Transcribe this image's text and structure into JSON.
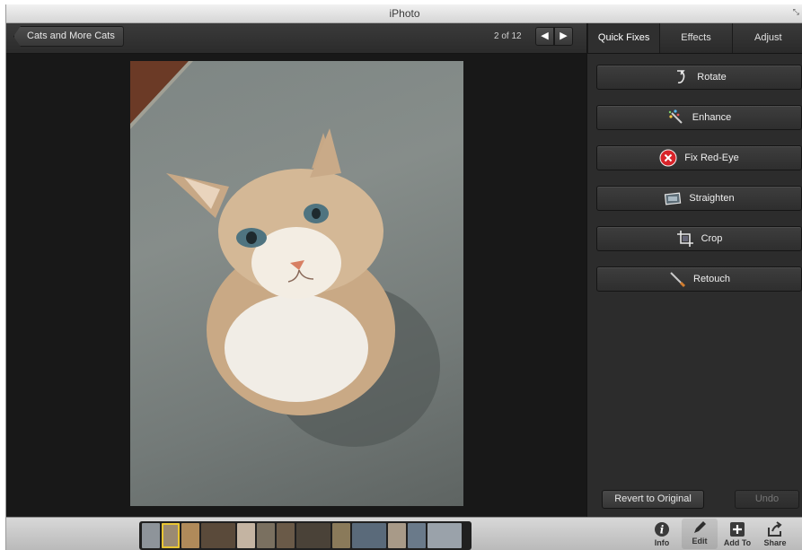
{
  "window": {
    "title": "iPhoto"
  },
  "toolbar": {
    "back_label": "Cats and More Cats",
    "counter": "2 of 12",
    "prev_glyph": "🡐",
    "next_glyph": "🡒"
  },
  "panel": {
    "tabs": [
      {
        "label": "Quick Fixes",
        "active": true
      },
      {
        "label": "Effects",
        "active": false
      },
      {
        "label": "Adjust",
        "active": false
      }
    ],
    "tools": [
      {
        "label": "Rotate",
        "icon": "rotate-icon"
      },
      {
        "label": "Enhance",
        "icon": "magic-wand-icon"
      },
      {
        "label": "Fix Red-Eye",
        "icon": "red-eye-icon"
      },
      {
        "label": "Straighten",
        "icon": "straighten-icon"
      },
      {
        "label": "Crop",
        "icon": "crop-icon"
      },
      {
        "label": "Retouch",
        "icon": "brush-icon"
      }
    ],
    "revert_label": "Revert to Original",
    "undo_label": "Undo"
  },
  "bottombar": {
    "items": [
      {
        "label": "Info",
        "icon": "info-icon"
      },
      {
        "label": "Edit",
        "icon": "pencil-icon",
        "active": true
      },
      {
        "label": "Add To",
        "icon": "plus-icon"
      },
      {
        "label": "Share",
        "icon": "share-icon"
      }
    ],
    "thumbnail_count": 13,
    "selected_thumbnail": 2
  },
  "colors": {
    "selected_thumb": "#e8c533",
    "red_eye": "#d9242a"
  }
}
